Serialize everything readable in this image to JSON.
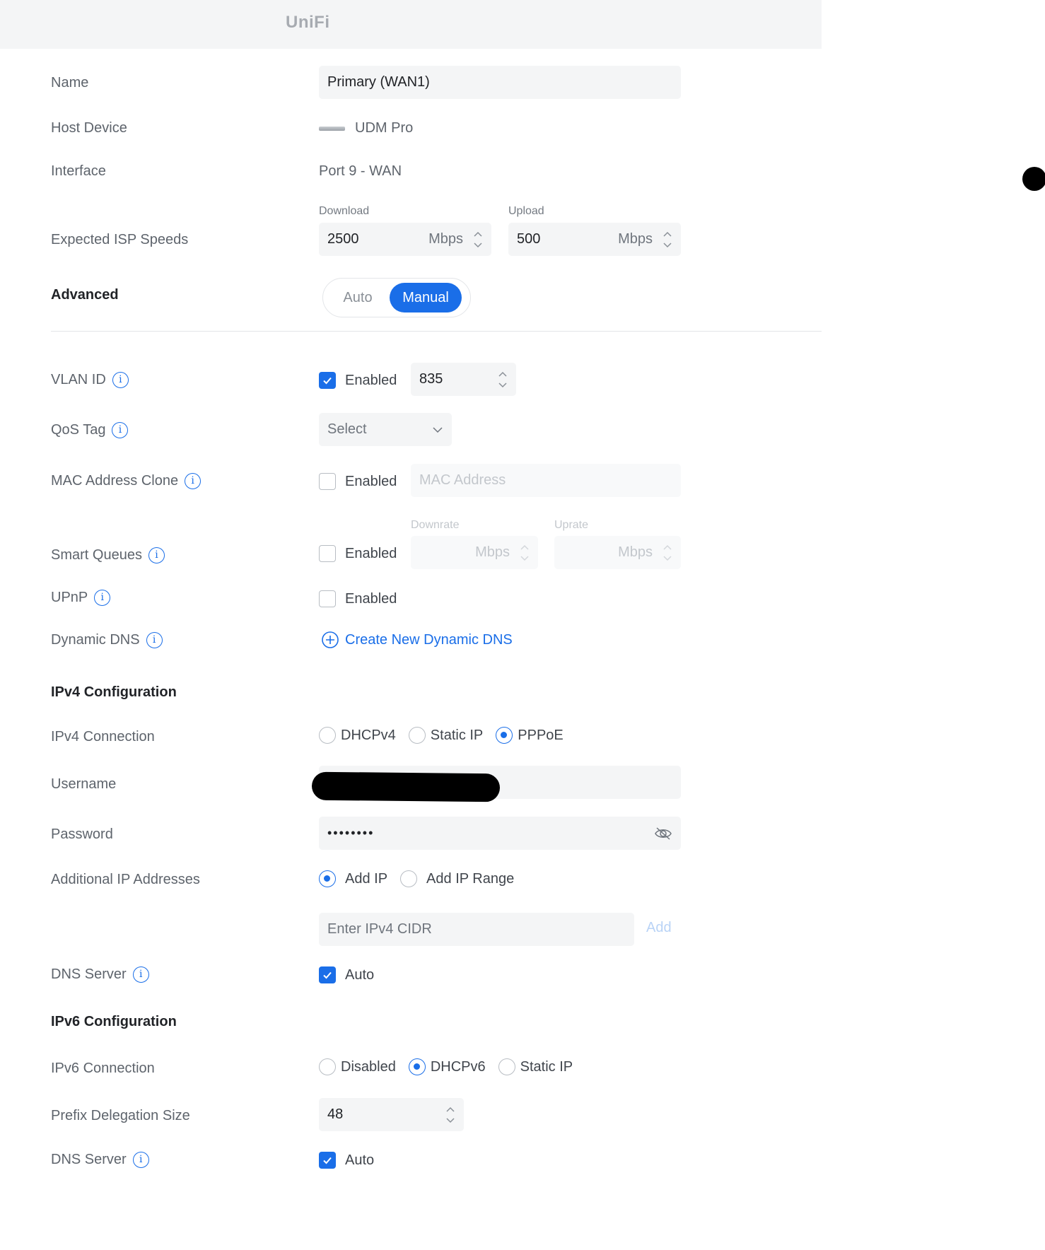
{
  "app": {
    "logo": "UniFi"
  },
  "form": {
    "name": {
      "label": "Name",
      "value": "Primary (WAN1)"
    },
    "host_device": {
      "label": "Host Device",
      "value": "UDM Pro"
    },
    "interface": {
      "label": "Interface",
      "value": "Port 9 - WAN"
    },
    "isp_speeds": {
      "label": "Expected ISP Speeds",
      "download_label": "Download",
      "download_value": "2500",
      "download_unit": "Mbps",
      "upload_label": "Upload",
      "upload_value": "500",
      "upload_unit": "Mbps"
    },
    "advanced": {
      "label": "Advanced",
      "option_auto": "Auto",
      "option_manual": "Manual",
      "selected": "Manual"
    },
    "vlan_id": {
      "label": "VLAN ID",
      "checkbox_label": "Enabled",
      "checked": true,
      "value": "835"
    },
    "qos_tag": {
      "label": "QoS Tag",
      "placeholder": "Select"
    },
    "mac_clone": {
      "label": "MAC Address Clone",
      "checkbox_label": "Enabled",
      "checked": false,
      "placeholder": "MAC Address"
    },
    "smart_queues": {
      "label": "Smart Queues",
      "checkbox_label": "Enabled",
      "checked": false,
      "downrate_label": "Downrate",
      "uprate_label": "Uprate",
      "unit": "Mbps"
    },
    "upnp": {
      "label": "UPnP",
      "checkbox_label": "Enabled",
      "checked": false
    },
    "dynamic_dns": {
      "label": "Dynamic DNS",
      "link": "Create New Dynamic DNS"
    },
    "ipv4": {
      "section_title": "IPv4 Configuration",
      "connection_label": "IPv4 Connection",
      "options": [
        "DHCPv4",
        "Static IP",
        "PPPoE"
      ],
      "selected": "PPPoE",
      "username_label": "Username",
      "password_label": "Password",
      "password_value": "••••••••",
      "additional_label": "Additional IP Addresses",
      "additional_options": [
        "Add IP",
        "Add IP Range"
      ],
      "additional_selected": "Add IP",
      "cidr_placeholder": "Enter IPv4 CIDR",
      "add_button": "Add",
      "dns_label": "DNS Server",
      "dns_checkbox": "Auto",
      "dns_checked": true
    },
    "ipv6": {
      "section_title": "IPv6 Configuration",
      "connection_label": "IPv6 Connection",
      "options": [
        "Disabled",
        "DHCPv6",
        "Static IP"
      ],
      "selected": "DHCPv6",
      "prefix_label": "Prefix Delegation Size",
      "prefix_value": "48",
      "dns_label": "DNS Server",
      "dns_checkbox": "Auto",
      "dns_checked": true
    }
  },
  "colors": {
    "accent": "#1a6ee8",
    "field_bg": "#f4f5f6",
    "label": "#5e646c"
  }
}
